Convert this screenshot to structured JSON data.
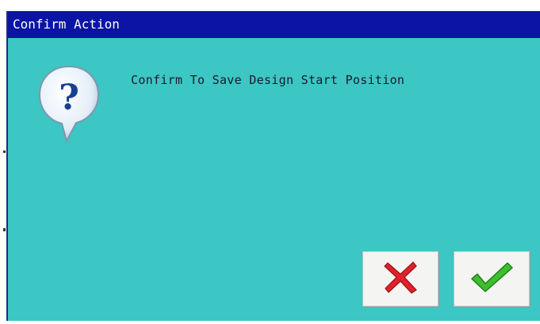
{
  "dialog": {
    "title": "Confirm Action",
    "message": "Confirm To Save Design Start Position",
    "icon": "question-icon",
    "buttons": {
      "cancel_icon": "red-x-icon",
      "confirm_icon": "green-check-icon"
    }
  },
  "colors": {
    "title_bar": "#0b14a4",
    "dialog_background": "#3cc6c4",
    "cancel_icon": "#e0202a",
    "confirm_icon": "#3cbf2e"
  }
}
